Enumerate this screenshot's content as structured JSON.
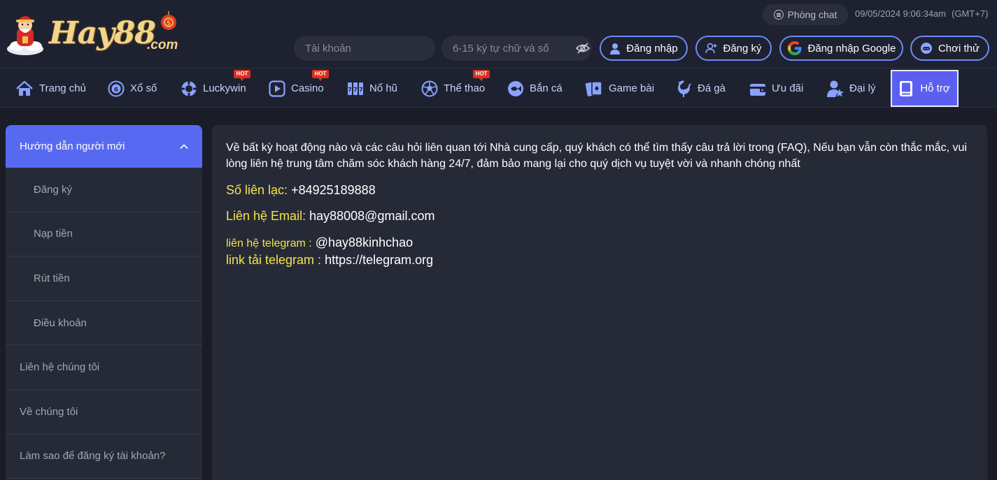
{
  "header": {
    "brand": "Hay88",
    "brand_suffix": ".com",
    "chat_label": "Phòng chat",
    "datetime": "09/05/2024 9:06:34am",
    "timezone": "(GMT+7)",
    "username_placeholder": "Tài khoản",
    "password_placeholder": "6-15 ký tự chữ và số",
    "login_label": "Đăng nhập",
    "register_label": "Đăng ký",
    "google_login_label": "Đăng nhập Google",
    "trial_label": "Chơi thử",
    "accent": "#6e8bf5"
  },
  "nav": {
    "items": [
      {
        "label": "Trang chủ",
        "icon": "home-icon"
      },
      {
        "label": "Xổ số",
        "icon": "lottery-icon"
      },
      {
        "label": "Luckywin",
        "icon": "chip-icon",
        "badge": "HOT"
      },
      {
        "label": "Casino",
        "icon": "play-icon",
        "badge": "HOT"
      },
      {
        "label": "Nổ hũ",
        "icon": "slot-icon"
      },
      {
        "label": "Thể thao",
        "icon": "soccer-icon",
        "badge": "HOT"
      },
      {
        "label": "Bắn cá",
        "icon": "fish-icon"
      },
      {
        "label": "Game bài",
        "icon": "cards-icon"
      },
      {
        "label": "Đá gà",
        "icon": "rooster-icon"
      },
      {
        "label": "Ưu đãi",
        "icon": "gift-icon"
      },
      {
        "label": "Đại lý",
        "icon": "agent-icon"
      },
      {
        "label": "Hỗ trợ",
        "icon": "support-book-icon",
        "active": true
      }
    ],
    "active_color": "#5b5ff0"
  },
  "sidebar": {
    "section_title": "Hướng dẫn người mới",
    "sub_items": [
      "Đăng ký",
      "Nạp tiền",
      "Rút tiền",
      "Điều khoản"
    ],
    "items": [
      "Liên hệ chúng tôi",
      "Về chúng tôi",
      "Làm sao để đăng ký tài khoản?"
    ]
  },
  "content": {
    "intro": "Về bất kỳ hoạt động nào và các câu hỏi liên quan tới Nhà cung cấp, quý khách có thể tìm thấy câu trả lời trong (FAQ), Nếu bạn vẫn còn thắc mắc, vui lòng liên hệ trung tâm chăm sóc khách hàng 24/7, đảm bảo mang lại cho quý dịch vụ tuyệt vời và nhanh chóng nhất",
    "phone_label": "Số liên lạc:",
    "phone_value": "+84925189888",
    "email_label": "Liên hệ Email:",
    "email_value": "hay88008@gmail.com",
    "telegram_label": "liên hệ telegram :",
    "telegram_value": "@hay88kinhchao",
    "telegram_link_label": "link tải telegram :",
    "telegram_link_value": "https://telegram.org",
    "highlight_color": "#f5e44a"
  }
}
